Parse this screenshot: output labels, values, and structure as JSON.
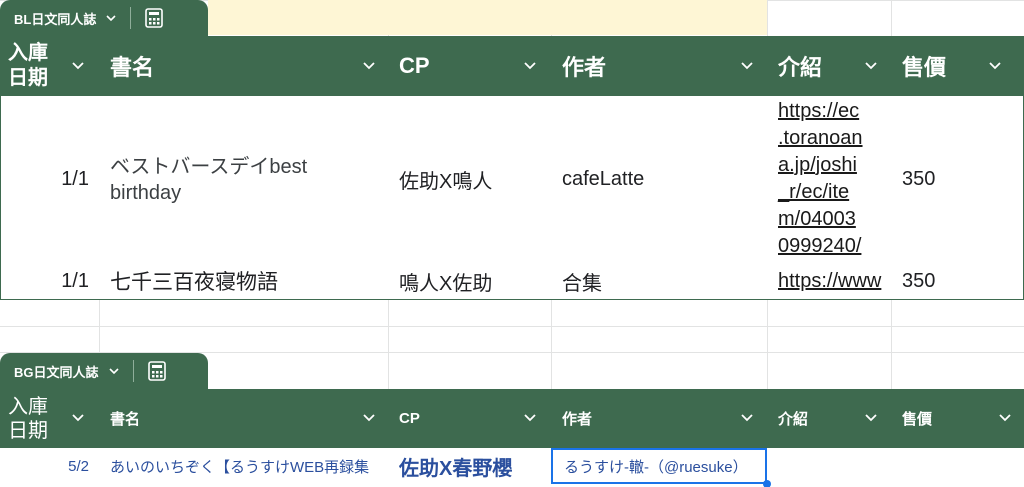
{
  "tables": [
    {
      "tab_name": "BL日文同人誌",
      "headers": [
        "入庫\n日期",
        "書名",
        "CP",
        "作者",
        "介紹",
        "售價"
      ],
      "rows": [
        {
          "date": "1/1",
          "title": "ベストバースデイbest\nbirthday",
          "cp": "佐助X鳴人",
          "author": "cafeLatte",
          "intro": "https://ec\n.toranoan\na.jp/joshi\n_r/ec/ite\nm/04003\n0999240/",
          "price": "350"
        },
        {
          "date": "1/1",
          "title": "七千三百夜寝物語",
          "cp": "鳴人X佐助",
          "author": "合集",
          "intro": "https://www",
          "price": "350"
        }
      ]
    },
    {
      "tab_name": "BG日文同人誌",
      "headers": [
        "入庫\n日期",
        "書名",
        "CP",
        "作者",
        "介紹",
        "售價"
      ],
      "rows": [
        {
          "date": "5/2",
          "title": "あいのいちぞく【るうすけWEB再録集",
          "cp": "佐助X春野櫻",
          "author": "るうすけ-轍-（@ruesuke）",
          "intro": "",
          "price": ""
        }
      ]
    }
  ],
  "icons": {
    "tab_menu": "chevron-down-icon",
    "table_view": "table-view-icon",
    "column_filter": "chevron-down-icon"
  },
  "colors": {
    "header_bg": "#3e6a4f",
    "header_text": "#ffffff",
    "selection": "#1a73e8",
    "bg_text": "#2b4f9e",
    "yellow_band": "#fef6d5"
  }
}
